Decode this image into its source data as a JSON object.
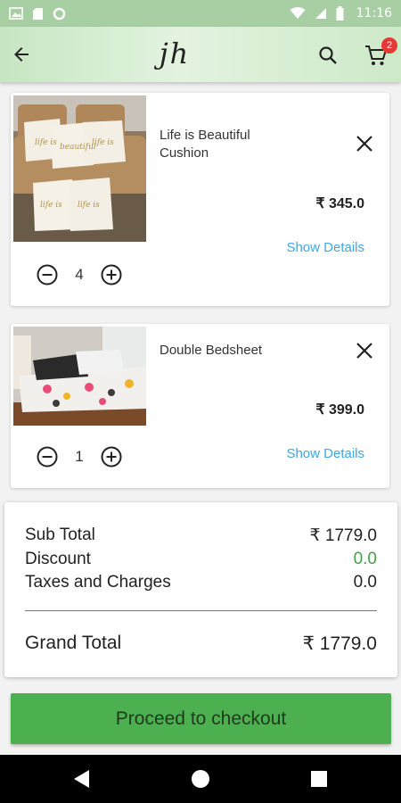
{
  "status_bar": {
    "time": "11:16"
  },
  "app_bar": {
    "logo": "jh",
    "cart_count": "2"
  },
  "cart_items": [
    {
      "name": "Life is Beautiful Cushion",
      "price": "₹ 345.0",
      "quantity": "4",
      "details_label": "Show Details"
    },
    {
      "name": "Double Bedsheet",
      "price": "₹ 399.0",
      "quantity": "1",
      "details_label": "Show Details"
    }
  ],
  "summary": {
    "subtotal_label": "Sub Total",
    "subtotal_value": "₹ 1779.0",
    "discount_label": "Discount",
    "discount_value": "0.0",
    "taxes_label": "Taxes and Charges",
    "taxes_value": "0.0",
    "grand_total_label": "Grand Total",
    "grand_total_value": "₹ 1779.0"
  },
  "checkout_label": "Proceed to checkout",
  "colors": {
    "accent_green": "#4caf50",
    "link_blue": "#3da7e6",
    "badge_red": "#e53935",
    "discount_green": "#43a047"
  }
}
